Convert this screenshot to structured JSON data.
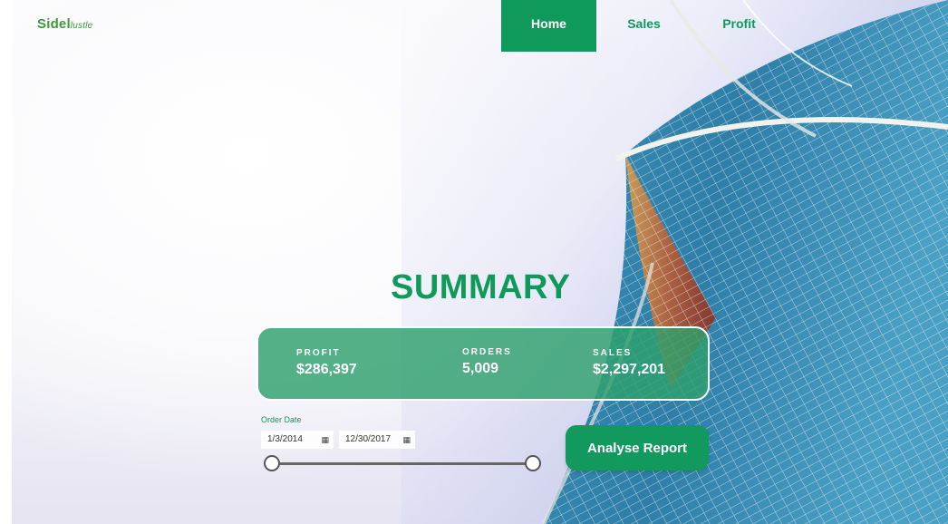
{
  "brand": {
    "logo_text": "Sidel",
    "logo_suffix": "lustle"
  },
  "nav": {
    "tabs": [
      {
        "label": "Home",
        "active": true
      },
      {
        "label": "Sales",
        "active": false
      },
      {
        "label": "Profit",
        "active": false
      }
    ]
  },
  "main": {
    "title": "SUMMARY"
  },
  "kpis": [
    {
      "label": "PROFIT",
      "value": "$286,397"
    },
    {
      "label": "ORDERS",
      "value": "5,009"
    },
    {
      "label": "SALES",
      "value": "$2,297,201"
    }
  ],
  "filter": {
    "label": "Order Date",
    "start": "1/3/2014",
    "end": "12/30/2017",
    "range_fraction": [
      0,
      1
    ]
  },
  "action": {
    "label": "Analyse Report"
  },
  "colors": {
    "accent": "#0f9a5c",
    "card": "#2ea06c"
  }
}
